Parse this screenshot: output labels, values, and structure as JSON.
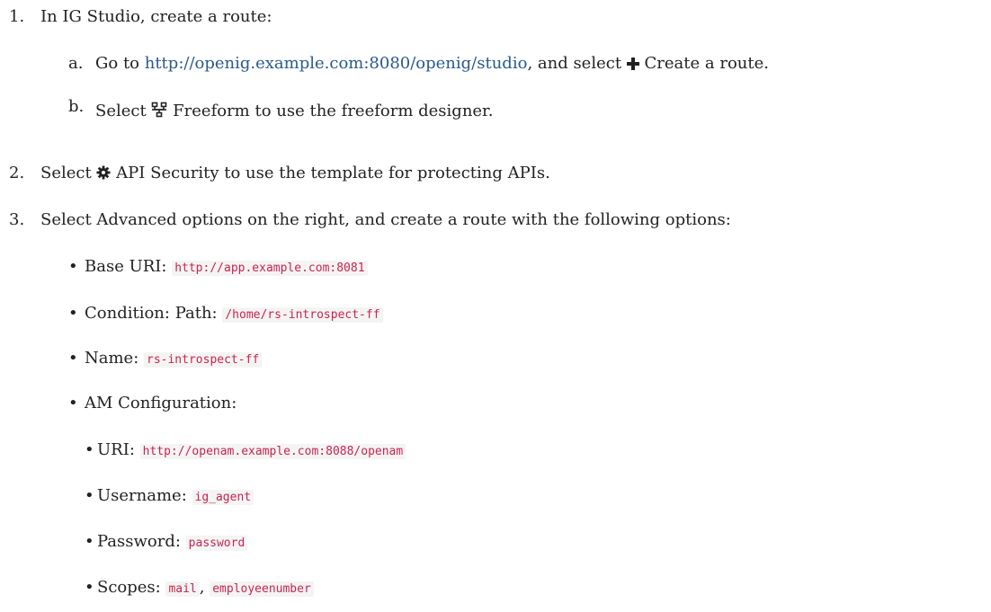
{
  "steps": [
    {
      "number": "1.",
      "text": "In IG Studio, create a route:",
      "substeps": [
        {
          "letter": "a.",
          "pre": "Go to ",
          "link": "http://openig.example.com:8080/openig/studio",
          "mid": ", and select ",
          "icon": "plus-icon",
          "action": "Create a route."
        },
        {
          "letter": "b.",
          "pre": "Select ",
          "icon": "freeform-icon",
          "action": "Freeform to use the freeform designer."
        }
      ]
    },
    {
      "number": "2.",
      "pre": "Select ",
      "icon": "gear-icon",
      "text": "API Security to use the template for protecting APIs."
    },
    {
      "number": "3.",
      "text": "Select Advanced options on the right, and create a route with the following options:",
      "options": [
        {
          "label": "Base URI: ",
          "value": "http://app.example.com:8081"
        },
        {
          "label": "Condition: Path: ",
          "value": "/home/rs-introspect-ff"
        },
        {
          "label": "Name: ",
          "value": "rs-introspect-ff"
        },
        {
          "label": "AM Configuration:"
        }
      ],
      "am_config": [
        {
          "label": "URI: ",
          "value": "http://openam.example.com:8088/openam"
        },
        {
          "label": "Username: ",
          "value": "ig_agent"
        },
        {
          "label": "Password: ",
          "value": "password"
        },
        {
          "label": "Scopes: ",
          "value": "mail",
          "sep": ", ",
          "value2": "employeenumber"
        }
      ]
    }
  ],
  "colors": {
    "text": "#222222",
    "link": "#2a5a8c",
    "code": "#c7254e"
  }
}
